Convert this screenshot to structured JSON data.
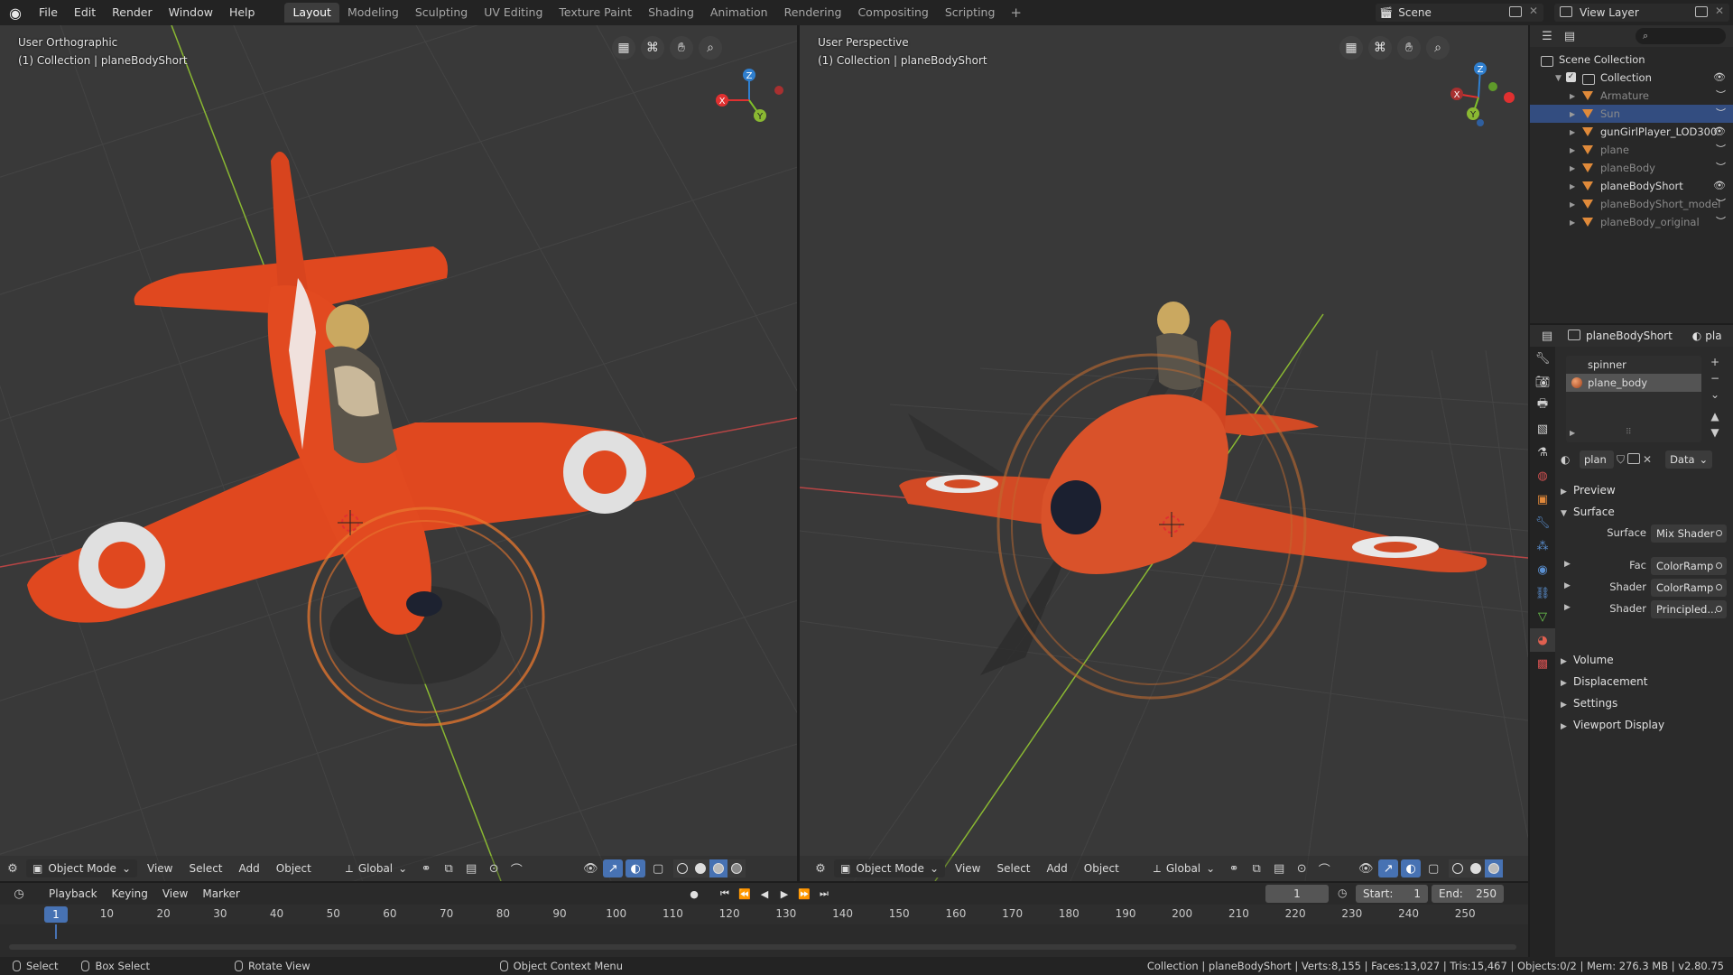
{
  "menubar": {
    "items": [
      "File",
      "Edit",
      "Render",
      "Window",
      "Help"
    ],
    "workspaces": [
      "Layout",
      "Modeling",
      "Sculpting",
      "UV Editing",
      "Texture Paint",
      "Shading",
      "Animation",
      "Rendering",
      "Compositing",
      "Scripting"
    ],
    "active_workspace": "Layout",
    "add_tab": "+",
    "scene": "Scene",
    "view_layer": "View Layer"
  },
  "viewport_left": {
    "view_name": "User Orthographic",
    "collection_info": "(1) Collection | planeBodyShort",
    "mode": "Object Mode",
    "menus": [
      "View",
      "Select",
      "Add",
      "Object"
    ],
    "orientation": "Global",
    "gizmo": {
      "x": "X",
      "y": "Y",
      "z": "Z"
    }
  },
  "viewport_right": {
    "view_name": "User Perspective",
    "collection_info": "(1) Collection | planeBodyShort",
    "mode": "Object Mode",
    "menus": [
      "View",
      "Select",
      "Add",
      "Object"
    ],
    "orientation": "Global",
    "gizmo": {
      "x": "X",
      "y": "Y",
      "z": "Z"
    }
  },
  "timeline": {
    "menus": [
      "Playback",
      "Keying",
      "View",
      "Marker"
    ],
    "current_frame": "1",
    "start_label": "Start:",
    "start_value": "1",
    "end_label": "End:",
    "end_value": "250",
    "ruler_frame": "1",
    "ticks": [
      "10",
      "20",
      "30",
      "40",
      "50",
      "60",
      "70",
      "80",
      "90",
      "100",
      "110",
      "120",
      "130",
      "140",
      "150",
      "160",
      "170",
      "180",
      "190",
      "200",
      "210",
      "220",
      "230",
      "240",
      "250"
    ]
  },
  "statusbar": {
    "select": "Select",
    "box_select": "Box Select",
    "rotate_view": "Rotate View",
    "context_menu": "Object Context Menu",
    "stats": "Collection | planeBodyShort | Verts:8,155 | Faces:13,027 | Tris:15,467 | Objects:0/2 | Mem: 276.3 MB | v2.80.75"
  },
  "outliner": {
    "root": "Scene Collection",
    "collection": "Collection",
    "items": [
      {
        "label": "Armature",
        "faded": true,
        "selected": false
      },
      {
        "label": "Sun",
        "faded": true,
        "selected": true
      },
      {
        "label": "gunGirlPlayer_LOD300",
        "faded": false,
        "selected": false
      },
      {
        "label": "plane",
        "faded": true,
        "selected": false
      },
      {
        "label": "planeBody",
        "faded": true,
        "selected": false
      },
      {
        "label": "planeBodyShort",
        "faded": false,
        "selected": false
      },
      {
        "label": "planeBodyShort_model",
        "faded": true,
        "selected": false
      },
      {
        "label": "planeBody_original",
        "faded": true,
        "selected": false
      }
    ]
  },
  "properties": {
    "object_name": "planeBodyShort",
    "header_extra": "pla",
    "slots": [
      "spinner",
      "plane_body"
    ],
    "material_field": "plan",
    "data_dropdown": "Data",
    "panels": {
      "preview": "Preview",
      "surface": "Surface",
      "volume": "Volume",
      "displacement": "Displacement",
      "settings": "Settings",
      "viewport_display": "Viewport Display"
    },
    "rows": [
      {
        "label": "Surface",
        "value": "Mix Shader"
      },
      {
        "label": "Fac",
        "value": "ColorRamp"
      },
      {
        "label": "Shader",
        "value": "ColorRamp"
      },
      {
        "label": "Shader",
        "value": "Principled..."
      }
    ]
  },
  "colors": {
    "accent": "#4772b3",
    "plane_orange": "#e0481f",
    "selection_orange": "#e8772e",
    "axis_red": "#b84545",
    "axis_green": "#8ab832"
  }
}
